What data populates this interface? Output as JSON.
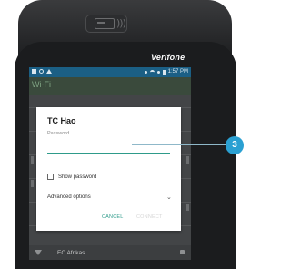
{
  "device": {
    "brand": "Verifone"
  },
  "status_bar": {
    "time": "1:57 PM"
  },
  "app_bar": {
    "title": "Wi-Fi"
  },
  "list": {
    "bottom_network": "EC Afrikas"
  },
  "dialog": {
    "title": "TC Hao",
    "password_label": "Password",
    "password_value": "",
    "show_password_label": "Show password",
    "show_password_checked": false,
    "advanced_options_label": "Advanced options",
    "cancel_label": "CANCEL",
    "connect_label": "CONNECT"
  },
  "callout": {
    "number": "3"
  },
  "colors": {
    "accent": "#2e9b8a",
    "status_bar": "#1b5f85",
    "callout": "#2aa0d2"
  }
}
